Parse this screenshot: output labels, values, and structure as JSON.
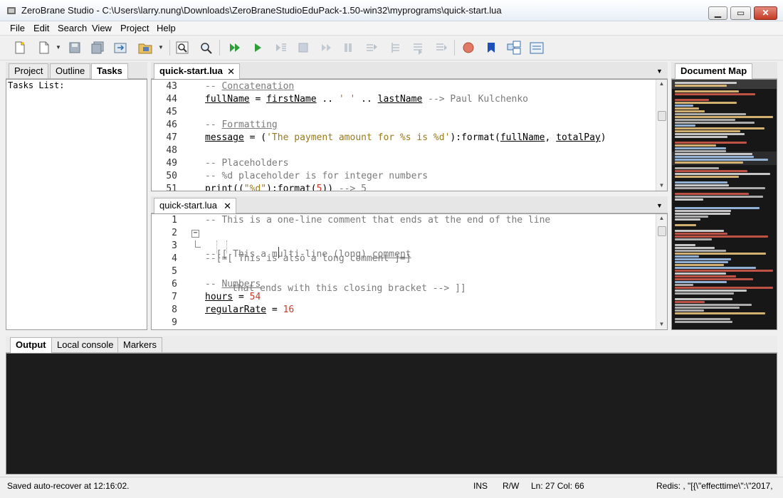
{
  "window": {
    "title": "ZeroBrane Studio - C:\\Users\\larry.nung\\Downloads\\ZeroBraneStudioEduPack-1.50-win32\\myprograms\\quick-start.lua",
    "minimize": "▁",
    "maximize": "▭",
    "close": "✕"
  },
  "menu": [
    "File",
    "Edit",
    "Search",
    "View",
    "Project",
    "Help"
  ],
  "toolbar": {
    "icons": [
      "new-file-icon",
      "open-file-icon",
      "save-icon",
      "save-all-icon",
      "project-directory-icon",
      "choose-project-icon",
      "find-icon",
      "find-in-files-icon",
      "run-icon",
      "start-debug-icon",
      "step-into-icon",
      "stop-icon",
      "step-over-icon",
      "break-icon",
      "step-out-icon",
      "run-to-cursor-icon",
      "trace-icon",
      "run-icon-2",
      "toggle-breakpoint-icon",
      "bookmark-icon",
      "stack-window-icon",
      "watch-window-icon"
    ]
  },
  "left_panel": {
    "tabs": [
      "Project",
      "Outline",
      "Tasks"
    ],
    "active_tab": "Tasks",
    "content": "Tasks List:"
  },
  "editor_top": {
    "tab": "quick-start.lua",
    "lines": [
      {
        "n": "43",
        "text": "-- Concatenation"
      },
      {
        "n": "44",
        "text": "fullName = firstName .. ' ' .. lastName --> Paul Kulchenko"
      },
      {
        "n": "45",
        "text": ""
      },
      {
        "n": "46",
        "text": "-- Formatting"
      },
      {
        "n": "47",
        "text": "message = ('The payment amount for %s is %d'):format(fullName, totalPay)"
      },
      {
        "n": "48",
        "text": ""
      },
      {
        "n": "49",
        "text": "-- Placeholders"
      },
      {
        "n": "50",
        "text": "-- %d placeholder is for integer numbers"
      },
      {
        "n": "51",
        "text": "print((\"%d\"):format(5)) --> 5"
      }
    ]
  },
  "editor_bottom": {
    "tab": "quick-start.lua",
    "lines": [
      {
        "n": "1",
        "text": "-- This is a one-line comment that ends at the end of the line"
      },
      {
        "n": "2",
        "text": "--[[ This a multi-line (long) comment"
      },
      {
        "n": "3",
        "text": "that ends with this closing bracket --> ]]"
      },
      {
        "n": "4",
        "text": "--[=[ This is also a long comment ]=]"
      },
      {
        "n": "5",
        "text": ""
      },
      {
        "n": "6",
        "text": "-- Numbers"
      },
      {
        "n": "7",
        "text": "hours = 54"
      },
      {
        "n": "8",
        "text": "regularRate = 16"
      },
      {
        "n": "9",
        "text": ""
      }
    ]
  },
  "document_map": {
    "tab": "Document Map"
  },
  "bottom_panel": {
    "tabs": [
      "Output",
      "Local console",
      "Markers"
    ],
    "active_tab": "Output"
  },
  "statusbar": {
    "message": "Saved auto-recover at 12:16:02.",
    "mode": "INS",
    "access": "R/W",
    "position": "Ln: 27 Col: 66",
    "redis": "Redis: , \"[{\\\"effecttime\\\":\\\"2017,"
  }
}
